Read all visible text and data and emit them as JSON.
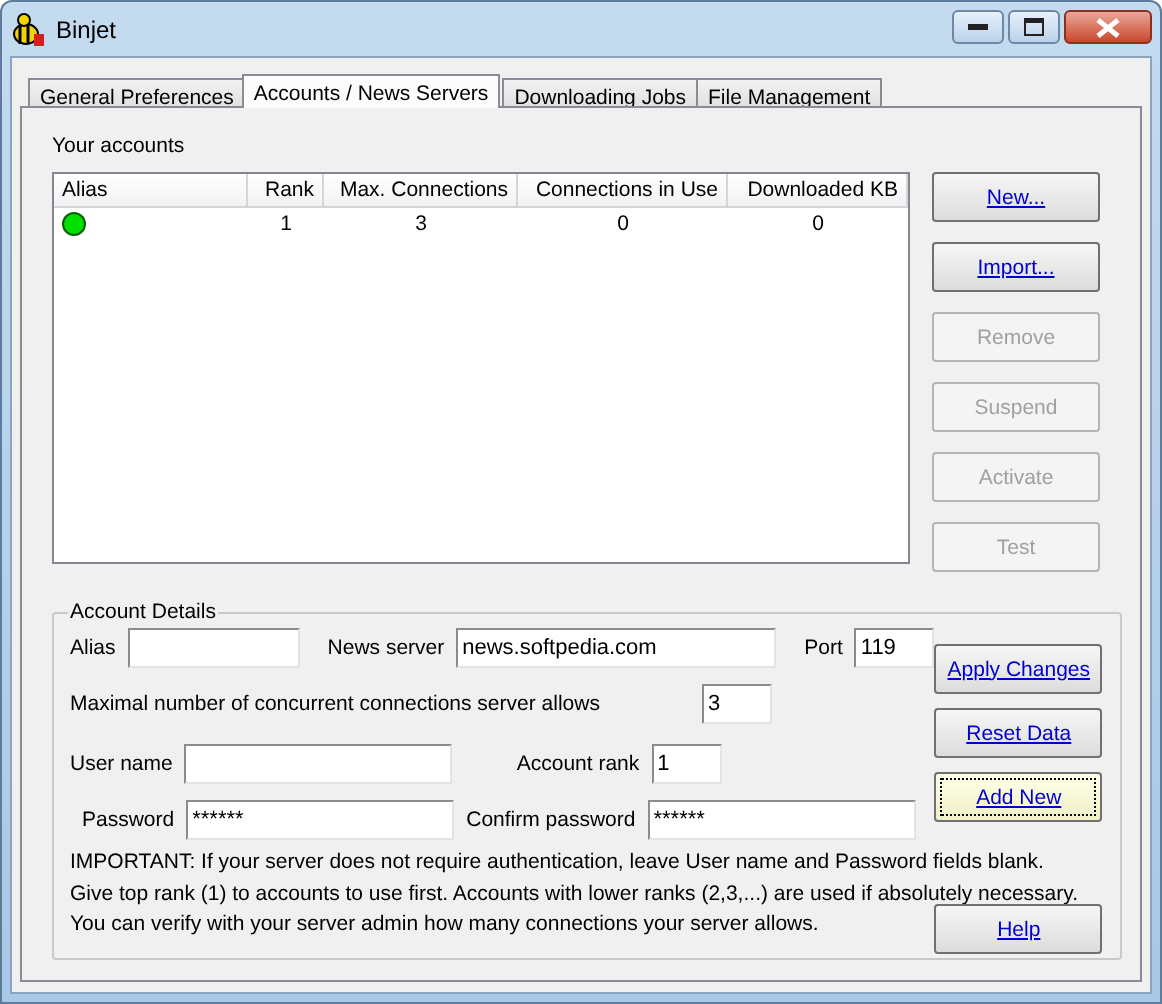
{
  "window": {
    "title": "Binjet"
  },
  "tabs": [
    {
      "label": "General Preferences",
      "selected": false
    },
    {
      "label": "Accounts / News Servers",
      "selected": true
    },
    {
      "label": "Downloading Jobs",
      "selected": false
    },
    {
      "label": "File Management",
      "selected": false
    }
  ],
  "accounts": {
    "label": "Your accounts",
    "columns": [
      "Alias",
      "Rank",
      "Max. Connections",
      "Connections in Use",
      "Downloaded KB"
    ],
    "rows": [
      {
        "color": "#00e000",
        "rank": "1",
        "max_connections": "3",
        "connections_in_use": "0",
        "downloaded_kb": "0"
      }
    ]
  },
  "account_buttons": [
    {
      "label": "New...",
      "disabled": false
    },
    {
      "label": "Import...",
      "disabled": false
    },
    {
      "label": "Remove",
      "disabled": true
    },
    {
      "label": "Suspend",
      "disabled": true
    },
    {
      "label": "Activate",
      "disabled": true
    },
    {
      "label": "Test",
      "disabled": true
    }
  ],
  "details": {
    "title": "Account Details",
    "alias": {
      "label": "Alias"
    },
    "news_server": {
      "label": "News server",
      "value": "news.softpedia.com"
    },
    "port": {
      "label": "Port",
      "value": "119"
    },
    "max_connections": {
      "label": "Maximal number of concurrent connections server allows",
      "value": "3"
    },
    "user_name": {
      "label": "User name"
    },
    "account_rank": {
      "label": "Account rank",
      "value": "1"
    },
    "password": {
      "label": "Password",
      "value": "******"
    },
    "confirm_password": {
      "label": "Confirm password",
      "value": "******"
    },
    "notice_lines": [
      "IMPORTANT: If your server does not require authentication, leave User name and Password fields blank.",
      "Give top rank (1) to accounts to use first. Accounts with lower ranks (2,3,...) are used if absolutely necessary.",
      "You can verify with your server admin how many connections your server allows."
    ],
    "buttons": [
      {
        "label": "Apply Changes",
        "focused": false
      },
      {
        "label": "Reset Data",
        "focused": false
      },
      {
        "label": "Add New",
        "focused": true
      }
    ],
    "help_button": {
      "label": "Help"
    }
  }
}
